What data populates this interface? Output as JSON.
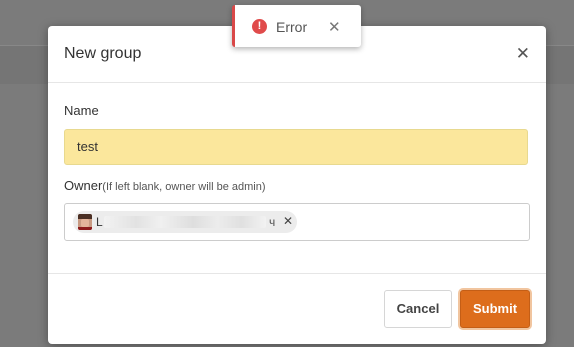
{
  "toast": {
    "icon": "error-icon",
    "icon_glyph": "!",
    "text": "Error",
    "close": "✕",
    "accent": "#d94848"
  },
  "modal": {
    "title": "New group",
    "close": "✕",
    "name": {
      "label": "Name",
      "value": "test"
    },
    "owner": {
      "label": "Owner",
      "hint": "(If left blank, owner will be admin)",
      "chip": {
        "first_char": "L",
        "last_char": "ч",
        "remove": "✕"
      }
    },
    "buttons": {
      "cancel": "Cancel",
      "submit": "Submit"
    },
    "colors": {
      "submit_bg": "#dd6d1c",
      "name_bg": "#fbe79c"
    }
  }
}
